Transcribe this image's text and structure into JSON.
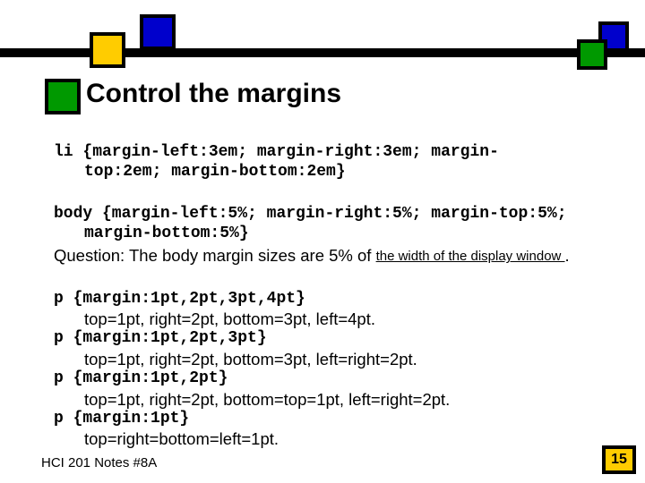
{
  "title": "Control the margins",
  "block1": {
    "line1": "li {margin-left:3em; margin-right:3em; margin-",
    "line2": "top:2em; margin-bottom:2em}"
  },
  "block2": {
    "line1": "body {margin-left:5%; margin-right:5%; margin-top:5%;",
    "line2": "margin-bottom:5%}",
    "question_prefix": "Question:  The body margin sizes are 5% of ",
    "answer": " the width of the display window ",
    "period": "."
  },
  "block3": {
    "p1_code": "p {margin:1pt,2pt,3pt,4pt}",
    "p1_desc": "top=1pt, right=2pt, bottom=3pt, left=4pt.",
    "p2_code": "p {margin:1pt,2pt,3pt}",
    "p2_desc": "top=1pt, right=2pt, bottom=3pt, left=right=2pt.",
    "p3_code": "p {margin:1pt,2pt}",
    "p3_desc": "top=1pt, right=2pt, bottom=top=1pt, left=right=2pt.",
    "p4_code": "p {margin:1pt}",
    "p4_desc": "top=right=bottom=left=1pt."
  },
  "footer": "HCI 201 Notes #8A",
  "pagenum": "15"
}
